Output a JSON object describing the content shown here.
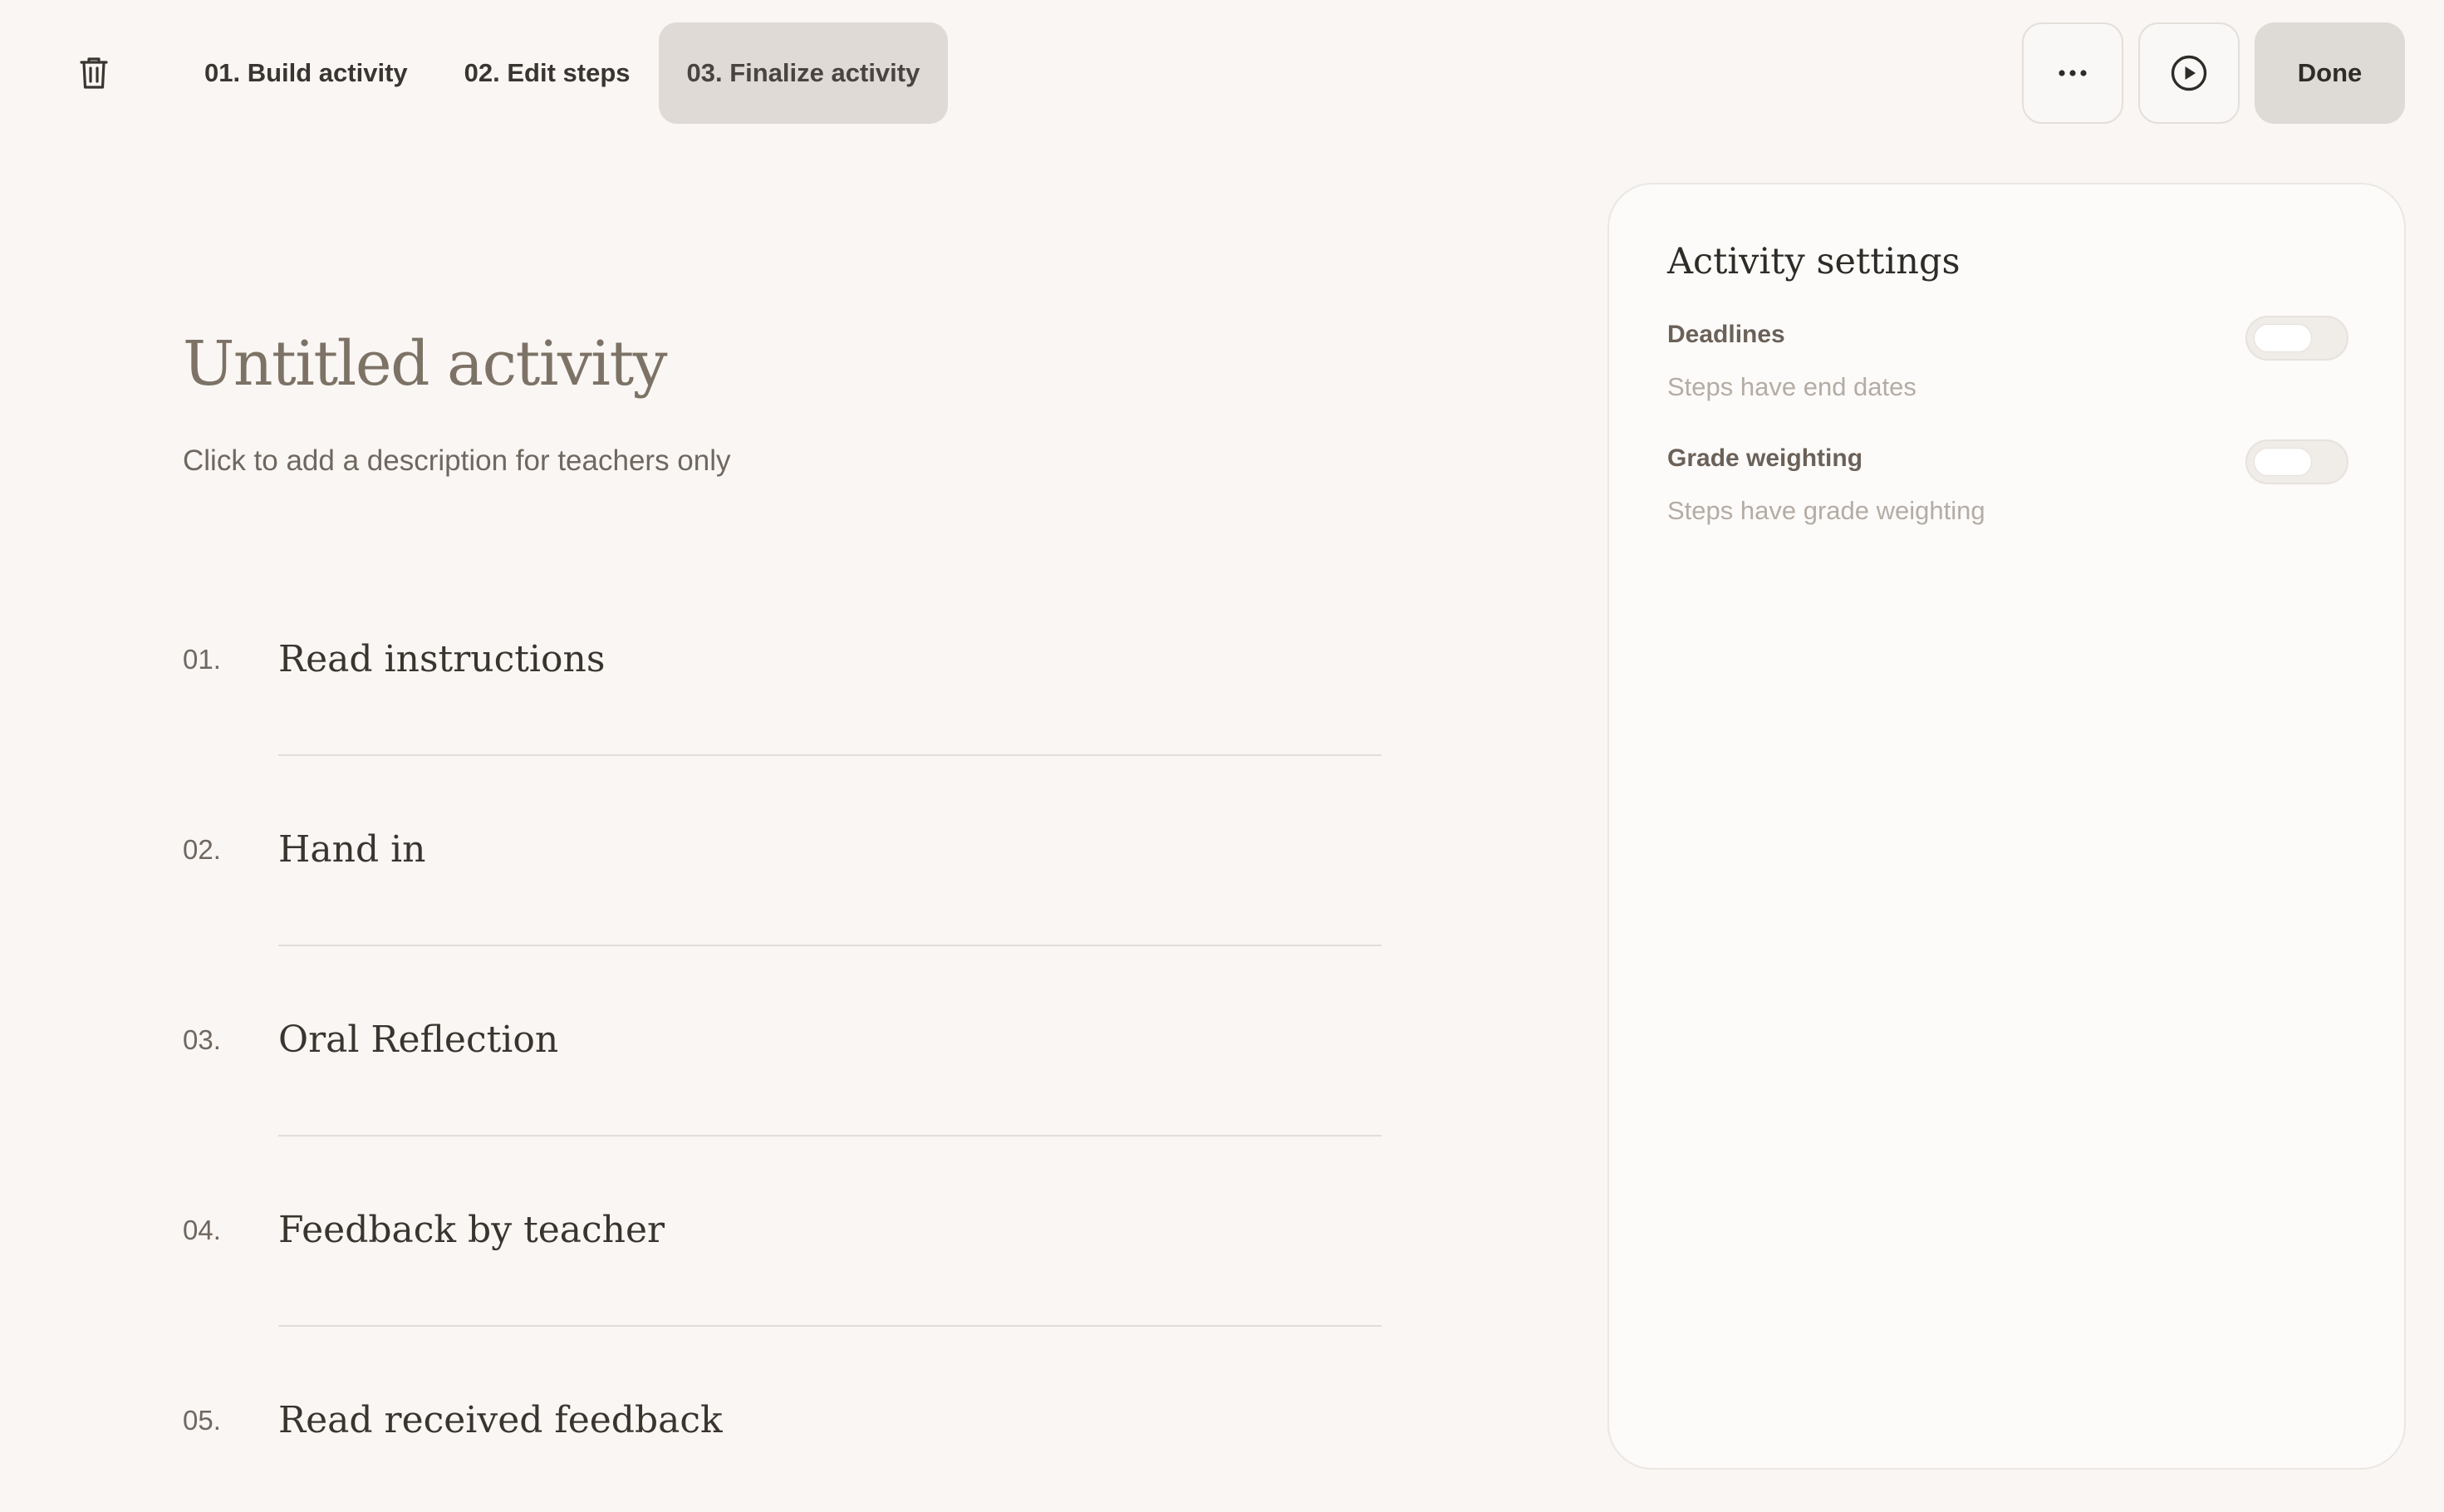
{
  "header": {
    "tabs": [
      {
        "label": "01. Build activity",
        "active": false
      },
      {
        "label": "02. Edit steps",
        "active": false
      },
      {
        "label": "03. Finalize activity",
        "active": true
      }
    ],
    "actions": {
      "more_icon": "more-horizontal-icon",
      "preview_icon": "play-circle-icon",
      "done_label": "Done"
    },
    "delete_icon": "trash-icon"
  },
  "activity": {
    "title": "Untitled activity",
    "description": "Click to add a description for teachers only"
  },
  "steps": [
    {
      "number": "01.",
      "name": "Read instructions"
    },
    {
      "number": "02.",
      "name": "Hand in"
    },
    {
      "number": "03.",
      "name": "Oral Reflection"
    },
    {
      "number": "04.",
      "name": "Feedback by teacher"
    },
    {
      "number": "05.",
      "name": "Read received feedback"
    }
  ],
  "settings": {
    "title": "Activity settings",
    "items": [
      {
        "label": "Deadlines",
        "description": "Steps have end dates",
        "enabled": false
      },
      {
        "label": "Grade weighting",
        "description": "Steps have grade weighting",
        "enabled": false
      }
    ]
  },
  "colors": {
    "background": "#f9f6f3",
    "active_tab": "#dfdad6",
    "title": "#7d7266",
    "panel": "#fcfbf9"
  }
}
